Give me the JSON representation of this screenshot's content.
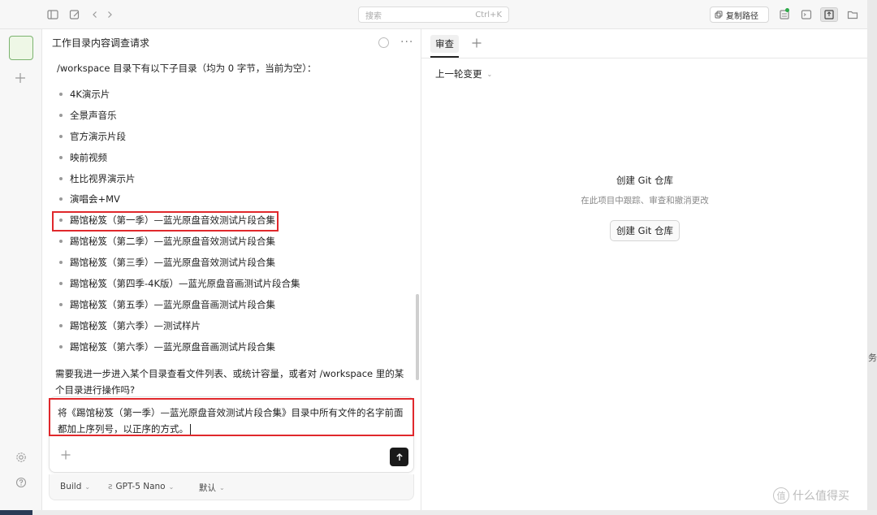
{
  "topbar": {
    "search_placeholder": "搜索",
    "search_shortcut": "Ctrl+K",
    "copy_path_label": "复制路径"
  },
  "chat": {
    "title": "工作目录内容调查请求",
    "intro": "/workspace 目录下有以下子目录（均为 0 字节，当前为空）：",
    "directories": [
      "4K演示片",
      "全景声音乐",
      "官方演示片段",
      "映前视频",
      "杜比视界演示片",
      "演唱会+MV",
      "踢馆秘笈（第一季）—蓝光原盘音效测试片段合集",
      "踢馆秘笈（第二季）—蓝光原盘音效测试片段合集",
      "踢馆秘笈（第三季）—蓝光原盘音效测试片段合集",
      "踢馆秘笈（第四季-4K版）—蓝光原盘音画测试片段合集",
      "踢馆秘笈（第五季）—蓝光原盘音画测试片段合集",
      "踢馆秘笈（第六季）—测试样片",
      "踢馆秘笈（第六季）—蓝光原盘音画测试片段合集"
    ],
    "followup": "需要我进一步进入某个目录查看文件列表、或统计容量，或者对 /workspace 里的某个目录进行操作吗?",
    "input_value": "将《踢馆秘笈（第一季）—蓝光原盘音效测试片段合集》目录中所有文件的名字前面都加上序列号，以正序的方式。"
  },
  "composer_bar": {
    "mode": "Build",
    "model": "GPT-5 Nano",
    "preset": "默认"
  },
  "review": {
    "tab_label": "审查",
    "prev_change_label": "上一轮变更",
    "git_title": "创建 Git 仓库",
    "git_subtitle": "在此项目中跟踪、审查和撤消更改",
    "git_button": "创建 Git 仓库"
  },
  "edge": {
    "glyph": "务"
  },
  "watermark": {
    "logo": "值",
    "text": "什么值得买"
  },
  "colors": {
    "highlight": "#e0282c",
    "status_green": "#2eaa4a",
    "send": "#1a1a1a"
  }
}
